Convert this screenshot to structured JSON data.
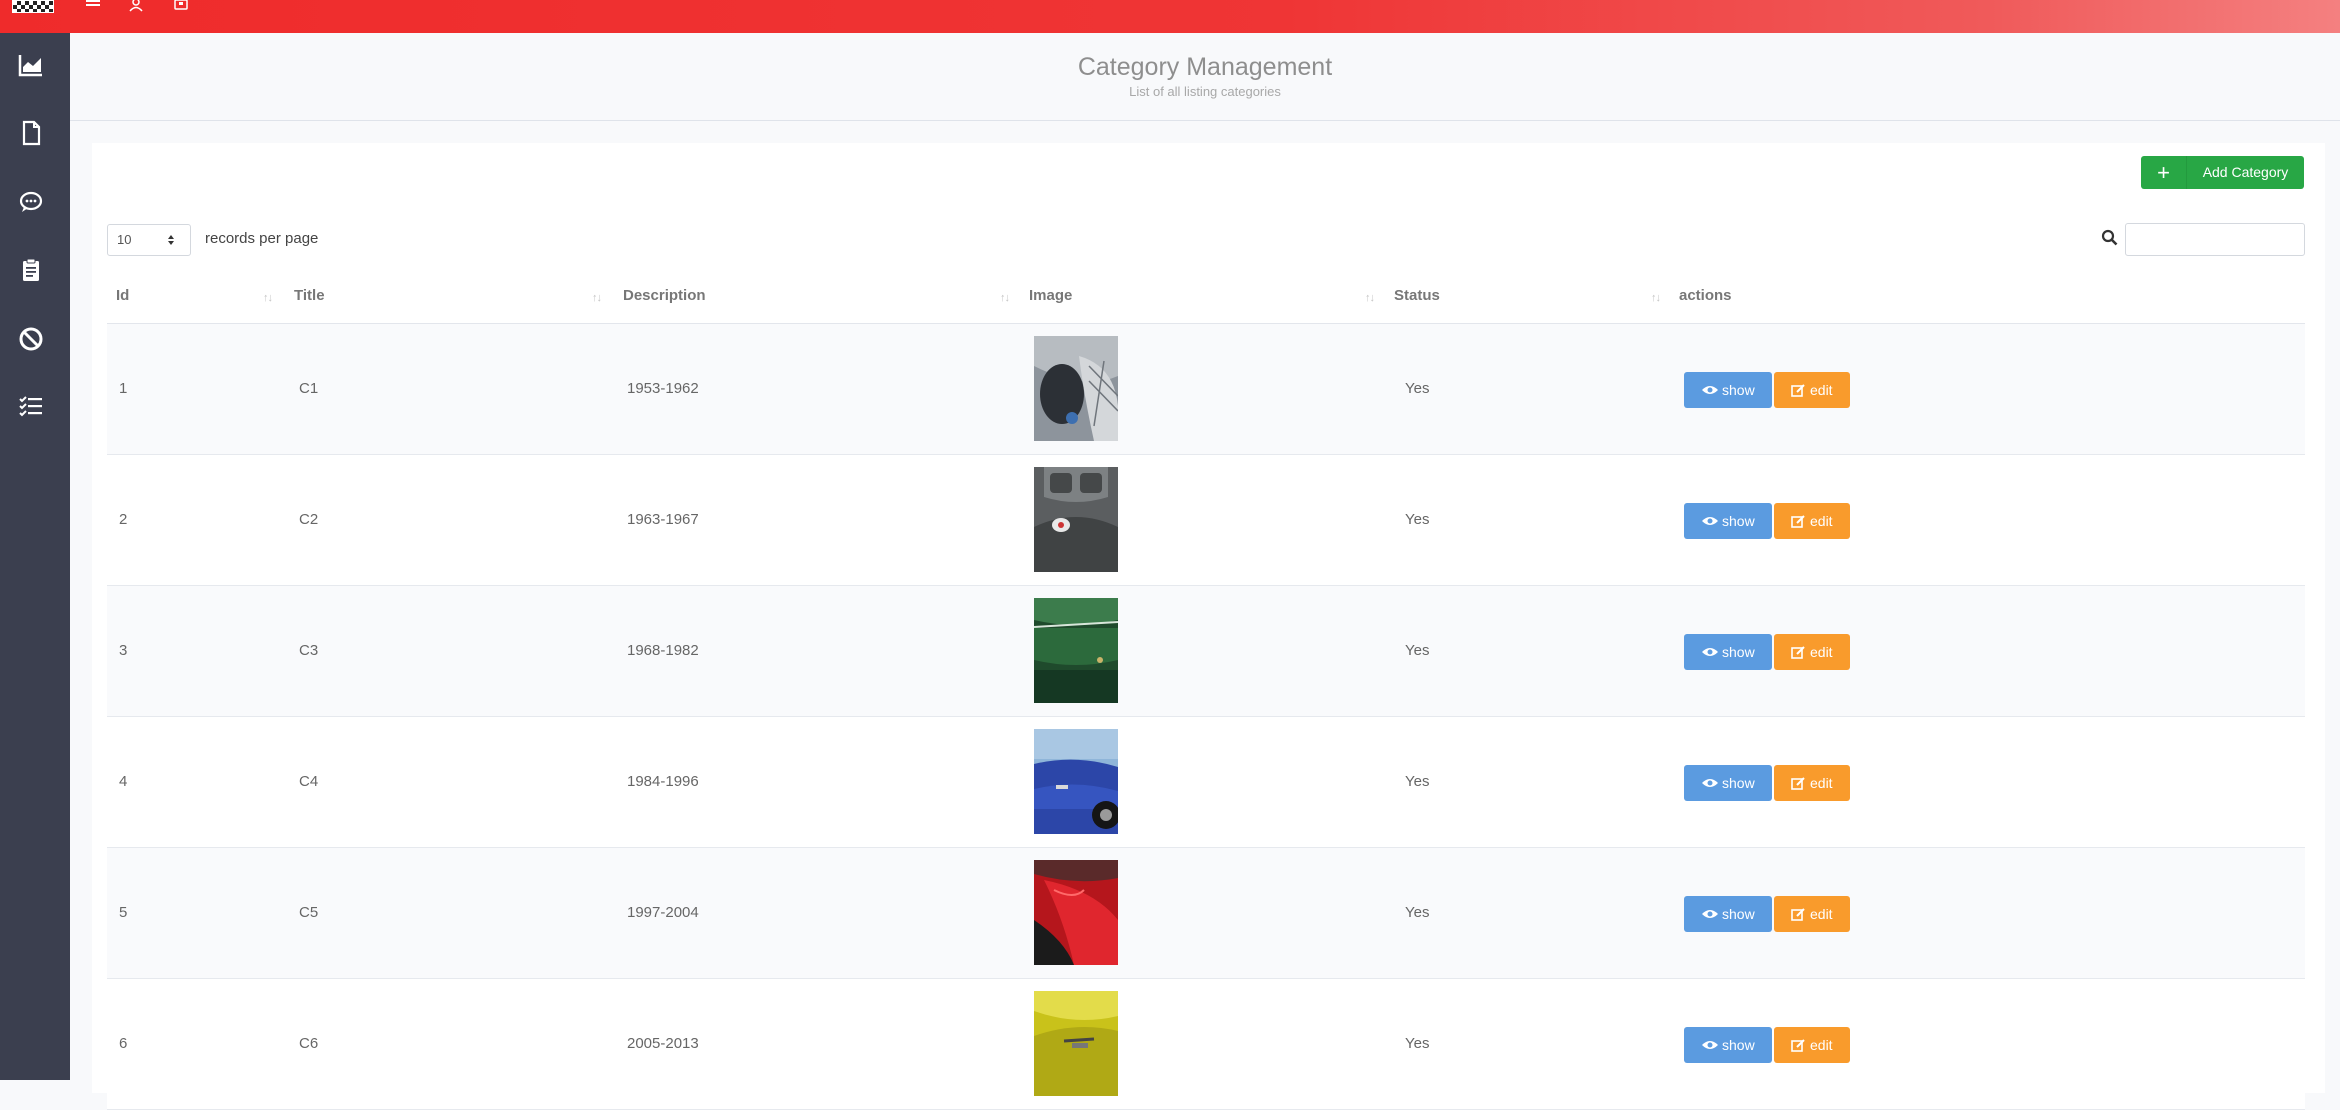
{
  "header": {
    "title": "Category Management",
    "subtitle": "List of all listing categories"
  },
  "toolbar": {
    "add_label": "Add Category",
    "add_icon": "+",
    "per_page_value": "10",
    "per_page_label": "records per page",
    "search_value": "",
    "search_placeholder": ""
  },
  "sidebar": {
    "items": [
      {
        "icon": "area-chart-icon"
      },
      {
        "icon": "file-icon"
      },
      {
        "icon": "comment-icon"
      },
      {
        "icon": "clipboard-icon"
      },
      {
        "icon": "ban-icon"
      },
      {
        "icon": "tasks-icon"
      }
    ]
  },
  "topbar": {
    "icons": [
      "menu-icon",
      "user-icon",
      "square-icon"
    ]
  },
  "table": {
    "columns": [
      "Id",
      "Title",
      "Description",
      "Image",
      "Status",
      "actions"
    ],
    "rows": [
      {
        "id": "1",
        "title": "C1",
        "description": "1953-1962",
        "status": "Yes",
        "show_label": "show",
        "edit_label": "edit"
      },
      {
        "id": "2",
        "title": "C2",
        "description": "1963-1967",
        "status": "Yes",
        "show_label": "show",
        "edit_label": "edit"
      },
      {
        "id": "3",
        "title": "C3",
        "description": "1968-1982",
        "status": "Yes",
        "show_label": "show",
        "edit_label": "edit"
      },
      {
        "id": "4",
        "title": "C4",
        "description": "1984-1996",
        "status": "Yes",
        "show_label": "show",
        "edit_label": "edit"
      },
      {
        "id": "5",
        "title": "C5",
        "description": "1997-2004",
        "status": "Yes",
        "show_label": "show",
        "edit_label": "edit"
      },
      {
        "id": "6",
        "title": "C6",
        "description": "2005-2013",
        "status": "Yes",
        "show_label": "show",
        "edit_label": "edit"
      }
    ]
  },
  "colors": {
    "topbar": "#ef2b2b",
    "sidebar": "#3b3f4f",
    "add_button": "#28a745",
    "show_button": "#5b9be0",
    "edit_button": "#f99b2c"
  }
}
